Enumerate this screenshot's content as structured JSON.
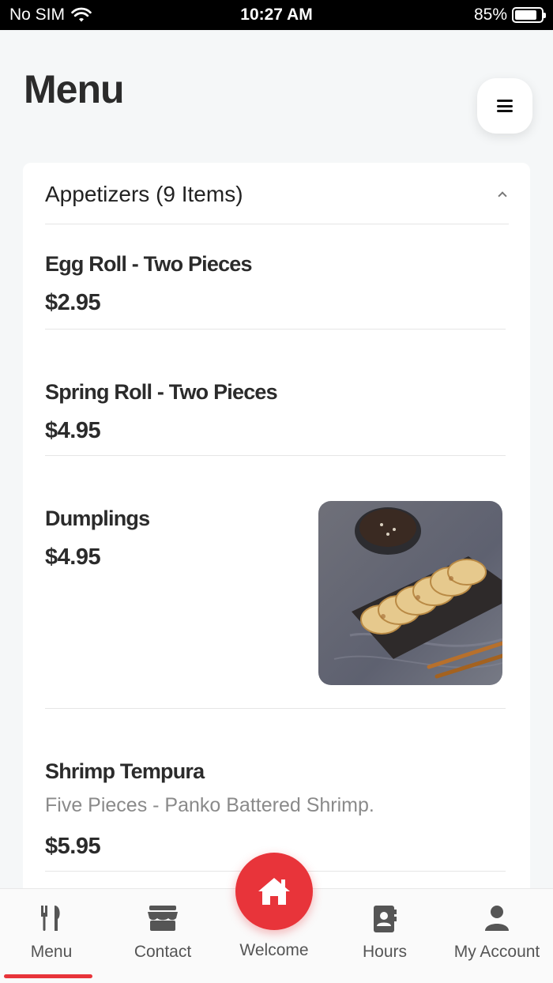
{
  "status_bar": {
    "carrier": "No SIM",
    "time": "10:27 AM",
    "battery": "85%",
    "battery_level": 0.85
  },
  "header": {
    "title": "Menu",
    "menu_icon": "hamburger-icon"
  },
  "category": {
    "title": "Appetizers (9 Items)",
    "toggle_icon": "chevron-up-icon",
    "items": [
      {
        "name": "Egg Roll - Two Pieces",
        "price": "$2.95"
      },
      {
        "name": "Spring Roll - Two Pieces",
        "price": "$4.95"
      },
      {
        "name": "Dumplings",
        "price": "$4.95",
        "image": "dumplings-photo"
      },
      {
        "name": "Shrimp Tempura",
        "description": "Five Pieces - Panko Battered Shrimp.",
        "price": "$5.95"
      }
    ]
  },
  "bottom_nav": {
    "items": [
      {
        "label": "Menu",
        "icon": "utensils-icon",
        "active": true
      },
      {
        "label": "Contact",
        "icon": "storefront-icon"
      },
      {
        "label": "Welcome",
        "icon": "home-icon"
      },
      {
        "label": "Hours",
        "icon": "contact-book-icon"
      },
      {
        "label": "My Account",
        "icon": "user-icon"
      }
    ],
    "accent_color": "#e8343a"
  }
}
